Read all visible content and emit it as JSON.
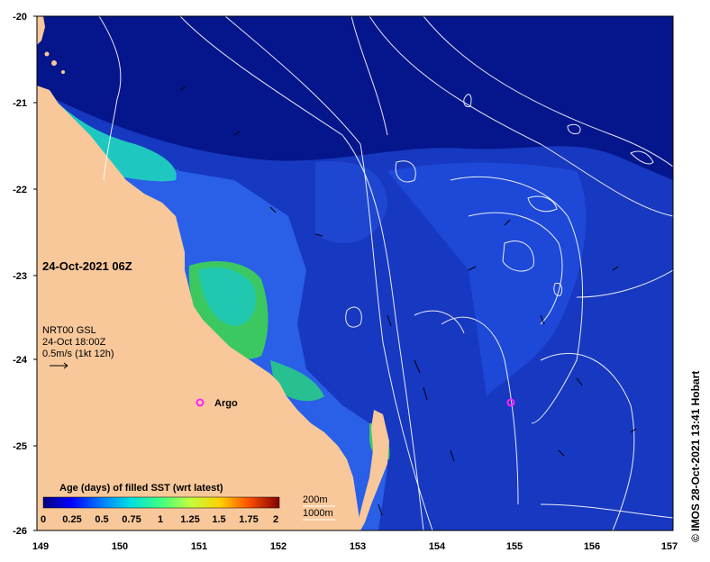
{
  "map": {
    "title": "24-Oct-2021 06Z",
    "lat_ticks": [
      "-20",
      "-21",
      "-22",
      "-23",
      "-24",
      "-25",
      "-26"
    ],
    "lon_ticks": [
      "149",
      "150",
      "151",
      "152",
      "153",
      "154",
      "155",
      "156",
      "157"
    ],
    "current_info": {
      "source": "NRT00 GSL",
      "time": "24-Oct 18:00Z",
      "scale": "0.5m/s (1kt 12h)"
    },
    "argo_label": "Argo",
    "contours": {
      "c200": "200m",
      "c1000": "1000m"
    },
    "colorbar": {
      "title": "Age (days) of filled SST (wrt latest)",
      "ticks": [
        "0",
        "0.25",
        "0.5",
        "0.75",
        "1",
        "1.25",
        "1.5",
        "1.75",
        "2"
      ]
    },
    "credit": "© IMOS 28-Oct-2021 13:41 Hobart",
    "colors": {
      "land": "#f8c89a",
      "ocean_deep": "#05168c",
      "ocean_mid": "#1f45d8",
      "ocean_shelf": "#2a6ff0",
      "age_cyan": "#1ed0c8",
      "age_green": "#3cc860",
      "argo": "#ff22ff"
    }
  }
}
